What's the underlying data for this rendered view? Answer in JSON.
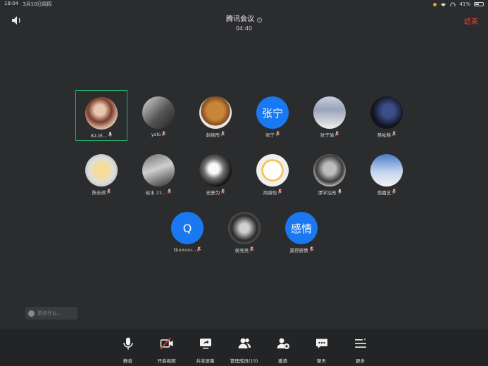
{
  "status_bar": {
    "time": "18:04",
    "date": "3月10日周四",
    "battery": "41%"
  },
  "header": {
    "title": "腾讯会议",
    "timer": "04:40",
    "end_label": "结束"
  },
  "participants": [
    {
      "name": "82-环...",
      "avatar": "photo",
      "avatar_text": ""
    },
    {
      "name": "yolo",
      "avatar": "photo",
      "avatar_text": ""
    },
    {
      "name": "赵婉彤",
      "avatar": "photo",
      "avatar_text": ""
    },
    {
      "name": "张宁",
      "avatar": "text",
      "avatar_text": "张宁"
    },
    {
      "name": "张子瑜",
      "avatar": "photo",
      "avatar_text": ""
    },
    {
      "name": "吴祉慈",
      "avatar": "photo",
      "avatar_text": ""
    },
    {
      "name": "陈永琪",
      "avatar": "photo",
      "avatar_text": ""
    },
    {
      "name": "给水 21...",
      "avatar": "photo",
      "avatar_text": ""
    },
    {
      "name": "史舒为",
      "avatar": "photo",
      "avatar_text": ""
    },
    {
      "name": "周骑怡",
      "avatar": "photo",
      "avatar_text": ""
    },
    {
      "name": "谭学泓彤",
      "avatar": "photo",
      "avatar_text": ""
    },
    {
      "name": "翁嘉艺",
      "avatar": "photo",
      "avatar_text": ""
    },
    {
      "name": "Quuuuu...",
      "avatar": "text",
      "avatar_text": "Q"
    },
    {
      "name": "侯亮亮",
      "avatar": "photo",
      "avatar_text": ""
    },
    {
      "name": "莫得感情",
      "avatar": "text",
      "avatar_text": "感情"
    }
  ],
  "chat": {
    "placeholder": "说点什么..."
  },
  "toolbar": [
    {
      "icon": "microphone-icon",
      "label": "静音"
    },
    {
      "icon": "video-off-icon",
      "label": "开启视频"
    },
    {
      "icon": "share-screen-icon",
      "label": "共享屏幕"
    },
    {
      "icon": "members-icon",
      "label": "管理成员(15)"
    },
    {
      "icon": "invite-icon",
      "label": "邀请"
    },
    {
      "icon": "chat-icon",
      "label": "聊天"
    },
    {
      "icon": "more-icon",
      "label": "更多"
    }
  ],
  "colors": {
    "accent": "#1a78f0",
    "end": "#e0453a",
    "selected": "#1fb36a"
  }
}
